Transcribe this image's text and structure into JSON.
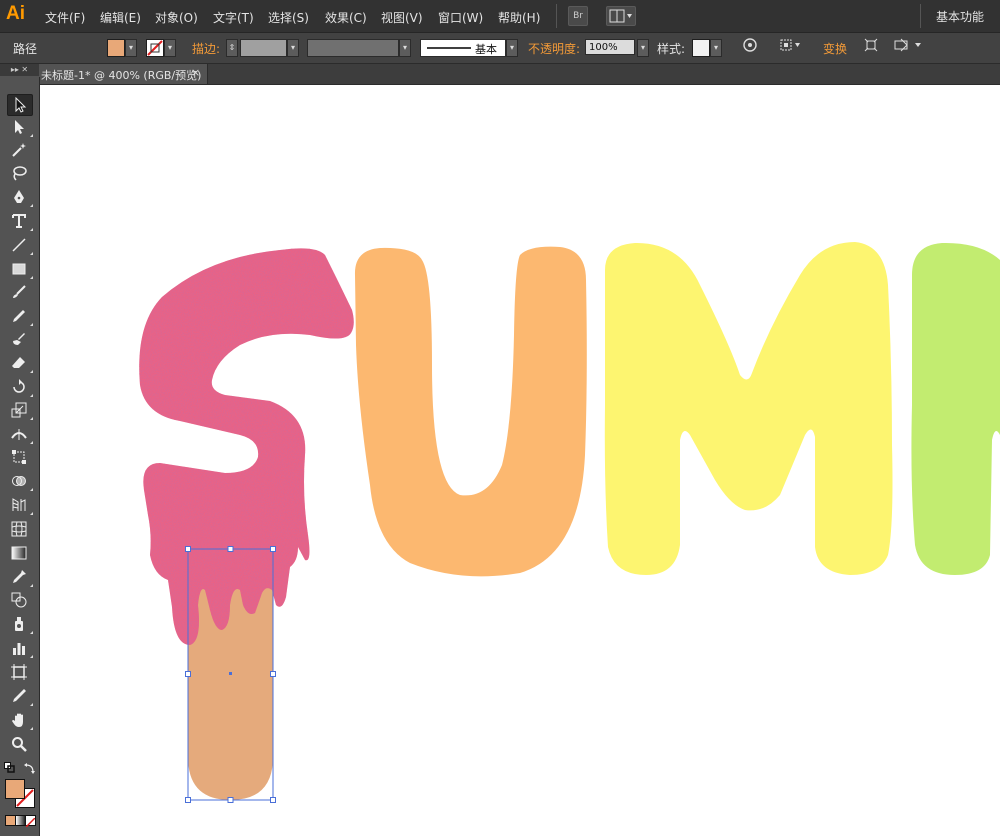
{
  "app": {
    "logo": "Ai",
    "workspace": "基本功能"
  },
  "menu": [
    "文件(F)",
    "编辑(E)",
    "对象(O)",
    "文字(T)",
    "选择(S)",
    "效果(C)",
    "视图(V)",
    "窗口(W)",
    "帮助(H)"
  ],
  "menu_buttons": {
    "bridge": "Br"
  },
  "control": {
    "object_type": "路径",
    "fill_color": "#e8a878",
    "stroke_label": "描边:",
    "brush_style": "基本",
    "opacity_label": "不透明度:",
    "opacity_value": "100%",
    "style_label": "样式:",
    "transform_label": "变换"
  },
  "document": {
    "tab_title": "未标题-1* @ 400% (RGB/预览)",
    "close": "×"
  },
  "tools": [
    "selection-tool",
    "direct-selection-tool",
    "magic-wand-tool",
    "lasso-tool",
    "pen-tool",
    "type-tool",
    "line-segment-tool",
    "rectangle-tool",
    "paintbrush-tool",
    "pencil-tool",
    "blob-brush-tool",
    "eraser-tool",
    "rotate-tool",
    "scale-tool",
    "width-tool",
    "free-transform-tool",
    "shape-builder-tool",
    "perspective-grid-tool",
    "mesh-tool",
    "gradient-tool",
    "eyedropper-tool",
    "blend-tool",
    "symbol-sprayer-tool",
    "column-graph-tool",
    "artboard-tool",
    "slice-tool",
    "hand-tool",
    "zoom-tool"
  ],
  "colors": {
    "letter_s": "#f06080",
    "letter_u": "#fcb870",
    "letter_m": "#fdf570",
    "letter_m2": "#c2ec70",
    "stick": "#e5aa7c",
    "selection": "#4a6fd8"
  }
}
